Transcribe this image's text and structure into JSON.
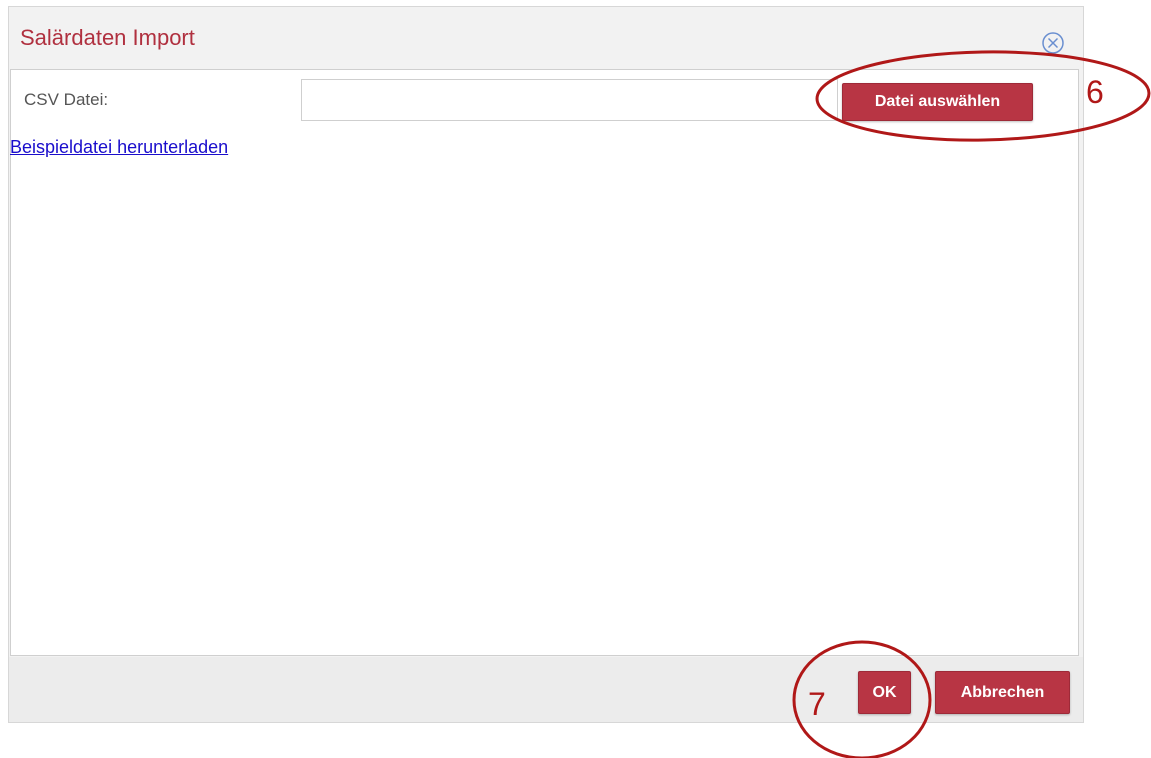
{
  "dialog": {
    "title": "Salärdaten Import",
    "close_icon": "close-circle-icon"
  },
  "form": {
    "csv_label": "CSV Datei:",
    "csv_value": "",
    "choose_button": "Datei auswählen",
    "sample_link": "Beispieldatei herunterladen"
  },
  "footer": {
    "ok_label": "OK",
    "cancel_label": "Abbrechen"
  },
  "annotations": {
    "marker_6": "6",
    "marker_7": "7",
    "color": "#b01818"
  },
  "colors": {
    "accent": "#b83544",
    "title": "#b0303f",
    "link": "#1a0dcc"
  }
}
